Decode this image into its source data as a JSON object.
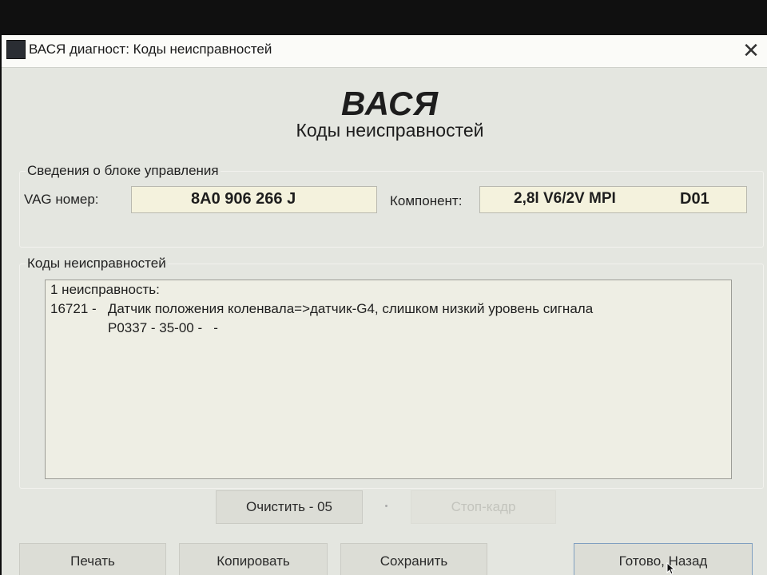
{
  "window": {
    "title": "ВАСЯ диагност: Коды неисправностей",
    "close_glyph": "✕"
  },
  "header": {
    "brand": "ВАСЯ",
    "subtitle": "Коды неисправностей"
  },
  "control_unit": {
    "group_label": "Сведения о блоке управления",
    "vag_label": "VAG номер:",
    "vag_value": "8A0 906 266 J",
    "component_label": "Компонент:",
    "component_value": "2,8l V6/2V MPI",
    "component_code": "D01"
  },
  "fault_codes": {
    "group_label": "Коды неисправностей",
    "lines": [
      "1 неисправность:",
      "16721 -   Датчик положения коленвала=>датчик-G4, слишком низкий уровень сигнала",
      "P0337 - 35-00 -   -"
    ]
  },
  "actions": {
    "clear_label": "Очистить - 05",
    "freeze_frame_label": "Стоп-кадр",
    "print_label": "Печать",
    "copy_label": "Копировать",
    "save_label": "Сохранить",
    "done_label": "Готово, Назад"
  }
}
